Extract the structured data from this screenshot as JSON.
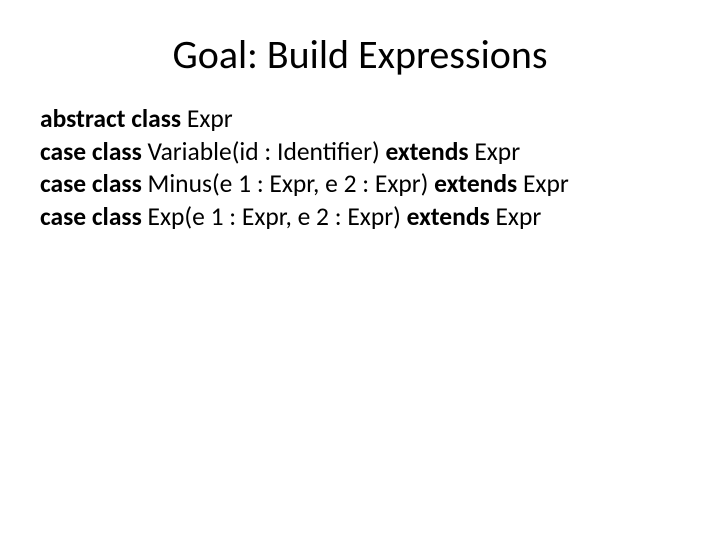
{
  "title": "Goal: Build Expressions",
  "lines": {
    "l1": {
      "kw": "abstract class ",
      "rest": "Expr"
    },
    "l2": {
      "kw1": "case class ",
      "mid": "Variable(id : Identifier) ",
      "kw2": "extends ",
      "tail": "Expr"
    },
    "l3": {
      "kw1": "case class ",
      "mid": "Minus(e 1 : Expr, e 2 : Expr) ",
      "kw2": "extends ",
      "tail": "Expr"
    },
    "l4": {
      "kw1": "case class ",
      "mid": "Exp(e 1 : Expr, e 2 : Expr) ",
      "kw2": "extends ",
      "tail": "Expr"
    }
  }
}
